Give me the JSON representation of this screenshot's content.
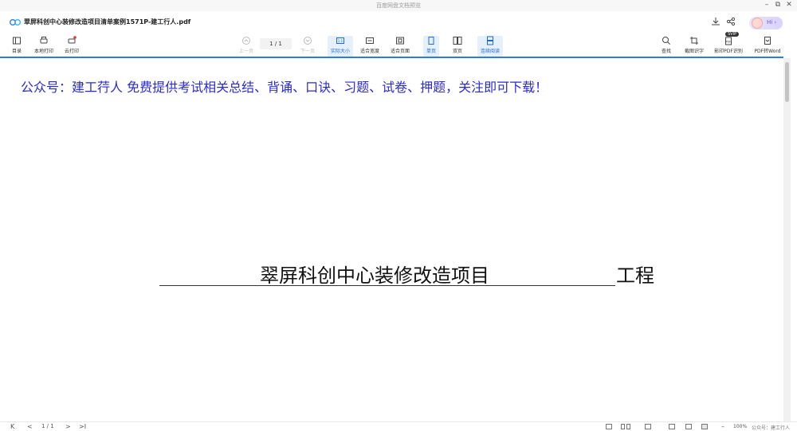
{
  "window": {
    "app_title": "百度网盘文档预览",
    "minimize": "–",
    "restore": "⧉",
    "close": "✕"
  },
  "file": {
    "name": "翠屏科创中心装修改造项目清单案例1571P-建工行人.pdf"
  },
  "header": {
    "hi_label": "Hi ›",
    "sale_badge": "SVIP"
  },
  "toolbar": {
    "left": [
      {
        "label": "目录"
      },
      {
        "label": "本地打印"
      },
      {
        "label": "云打印"
      }
    ],
    "nav": {
      "prev": "上一页",
      "page_indicator": "1 / 1",
      "next": "下一页"
    },
    "view": [
      {
        "label": "实际大小"
      },
      {
        "label": "适合宽度"
      },
      {
        "label": "适合页面"
      },
      {
        "label": "单页"
      },
      {
        "label": "双页"
      },
      {
        "label": "连续阅读"
      }
    ],
    "right": [
      {
        "label": "查找"
      },
      {
        "label": "截图识字"
      },
      {
        "label": "影印PDF识别"
      },
      {
        "label": "PDF转Word"
      }
    ]
  },
  "document": {
    "notice": "公众号：建工荇人 免费提供考试相关总结、背诵、口诀、习题、试卷、押题，关注即可下载！",
    "project_name": "翠屏科创中心装修改造项目",
    "project_suffix": "工程"
  },
  "footer": {
    "first": "K",
    "prev": "<",
    "page": "1 / 1",
    "next": ">",
    "last": ">I",
    "zoom_minus": "–",
    "zoom": "100%",
    "watermark": "公众号：建工行人"
  },
  "colors": {
    "accent": "#2f7be6",
    "notice_text": "#2b2bd0"
  }
}
